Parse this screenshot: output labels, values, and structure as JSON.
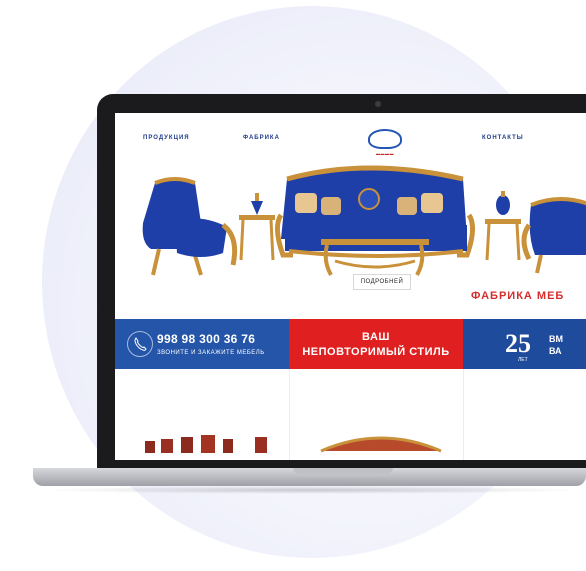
{
  "nav": {
    "items": [
      "ПРОДУКЦИЯ",
      "ФАБРИКА",
      "КОНТАКТЫ"
    ]
  },
  "hero": {
    "more_button": "ПОДРОБНЕЙ",
    "tagline": "ФАБРИКА МЕБ"
  },
  "bands": {
    "phone_number": "998 98 300 36 76",
    "phone_caption": "ЗВОНИТЕ И ЗАКАЖИТЕ МЕБЕЛЬ",
    "style_line1": "ВАШ",
    "style_line2": "НЕПОВТОРИМЫЙ СТИЛЬ",
    "years_number": "25",
    "years_word": "ЛЕТ",
    "years_tail_1": "ВМ",
    "years_tail_2": "ВА"
  },
  "icons": {
    "phone": "phone-icon",
    "logo": "brand-logo"
  },
  "colors": {
    "blue": "#2455a8",
    "red": "#e02020",
    "upholstery": "#1f3fa8",
    "gold": "#c8913a"
  }
}
